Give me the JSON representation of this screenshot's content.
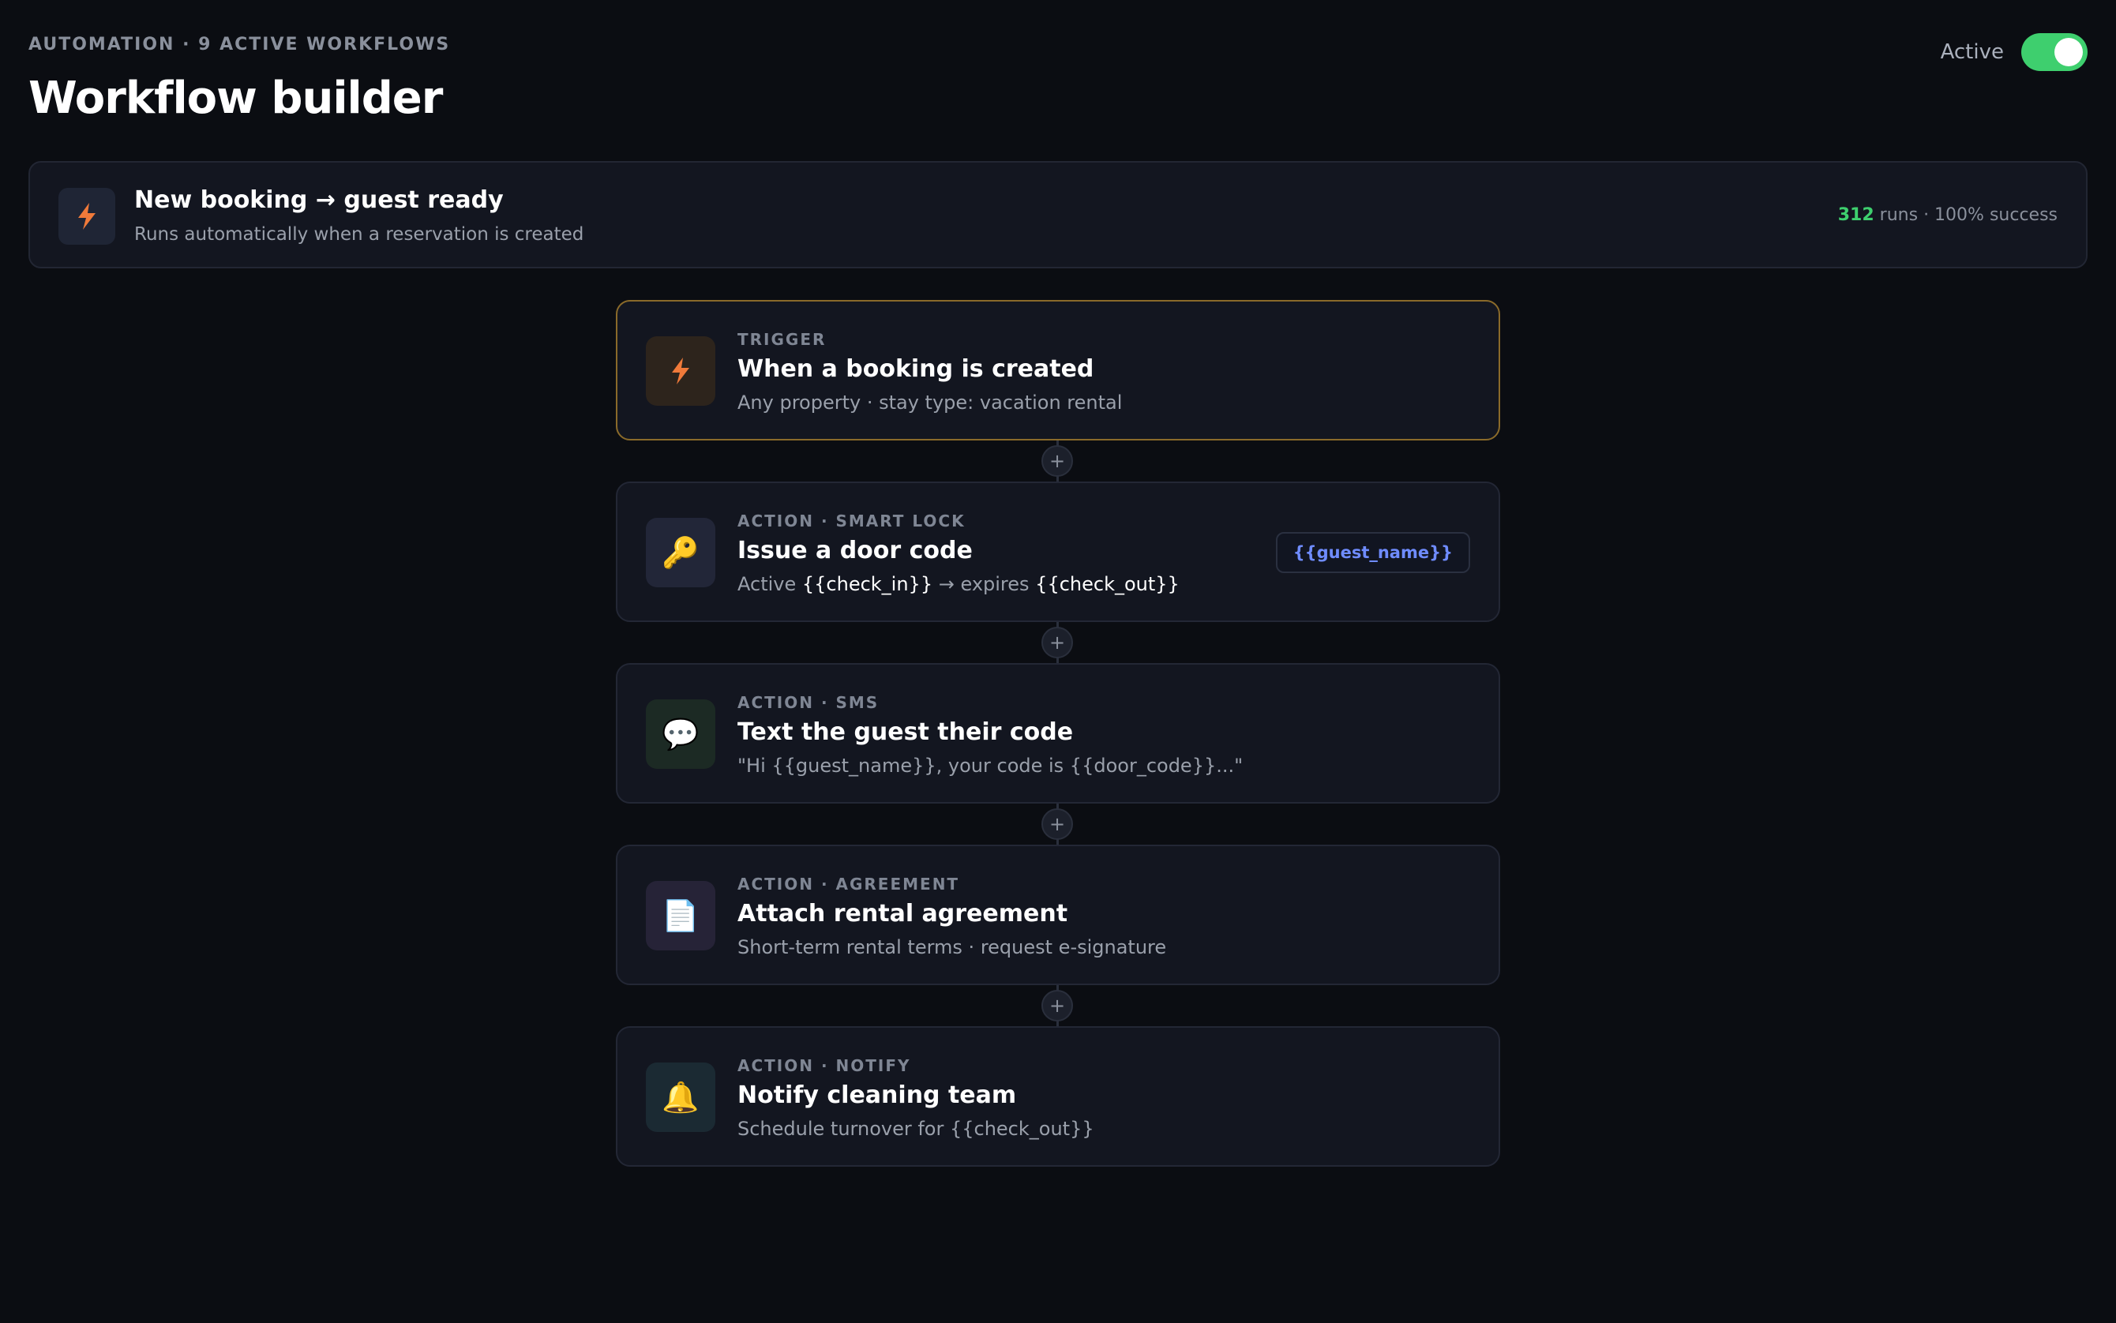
{
  "header": {
    "eyebrow": "AUTOMATION · 9 ACTIVE WORKFLOWS",
    "title": "Workflow builder",
    "status_label": "Active",
    "toggle_on": true
  },
  "summary": {
    "icon": "lightning-bolt-icon",
    "title": "New booking → guest ready",
    "subtitle": "Runs automatically when a reservation is created",
    "runs_count": "312",
    "runs_suffix": " runs · 100% success"
  },
  "connectors": {
    "add_label": "+"
  },
  "steps": [
    {
      "kind": "TRIGGER",
      "title": "When a booking is created",
      "desc": "Any property · stay type: vacation rental",
      "icon": "lightning-bolt-icon"
    },
    {
      "kind": "ACTION · SMART LOCK",
      "title": "Issue a door code",
      "desc_prefix": "Active ",
      "desc_var1": "{{check_in}}",
      "desc_mid": " → expires ",
      "desc_var2": "{{check_out}}",
      "chip": "{{guest_name}}",
      "icon": "key-icon",
      "icon_glyph": "🔑"
    },
    {
      "kind": "ACTION · SMS",
      "title": "Text the guest their code",
      "desc": "\"Hi {{guest_name}}, your code is {{door_code}}...\"",
      "icon": "speech-bubble-icon",
      "icon_glyph": "💬"
    },
    {
      "kind": "ACTION · AGREEMENT",
      "title": "Attach rental agreement",
      "desc": "Short-term rental terms · request e-signature",
      "icon": "document-icon",
      "icon_glyph": "📄"
    },
    {
      "kind": "ACTION · NOTIFY",
      "title": "Notify cleaning team",
      "desc": "Schedule turnover for {{check_out}}",
      "icon": "bell-icon",
      "icon_glyph": "🔔"
    }
  ],
  "colors": {
    "accent_green": "#3ecf6e",
    "bolt_orange": "#f07a3a",
    "chip_blue": "#6f8cff",
    "trigger_border": "#8a6a2a"
  }
}
